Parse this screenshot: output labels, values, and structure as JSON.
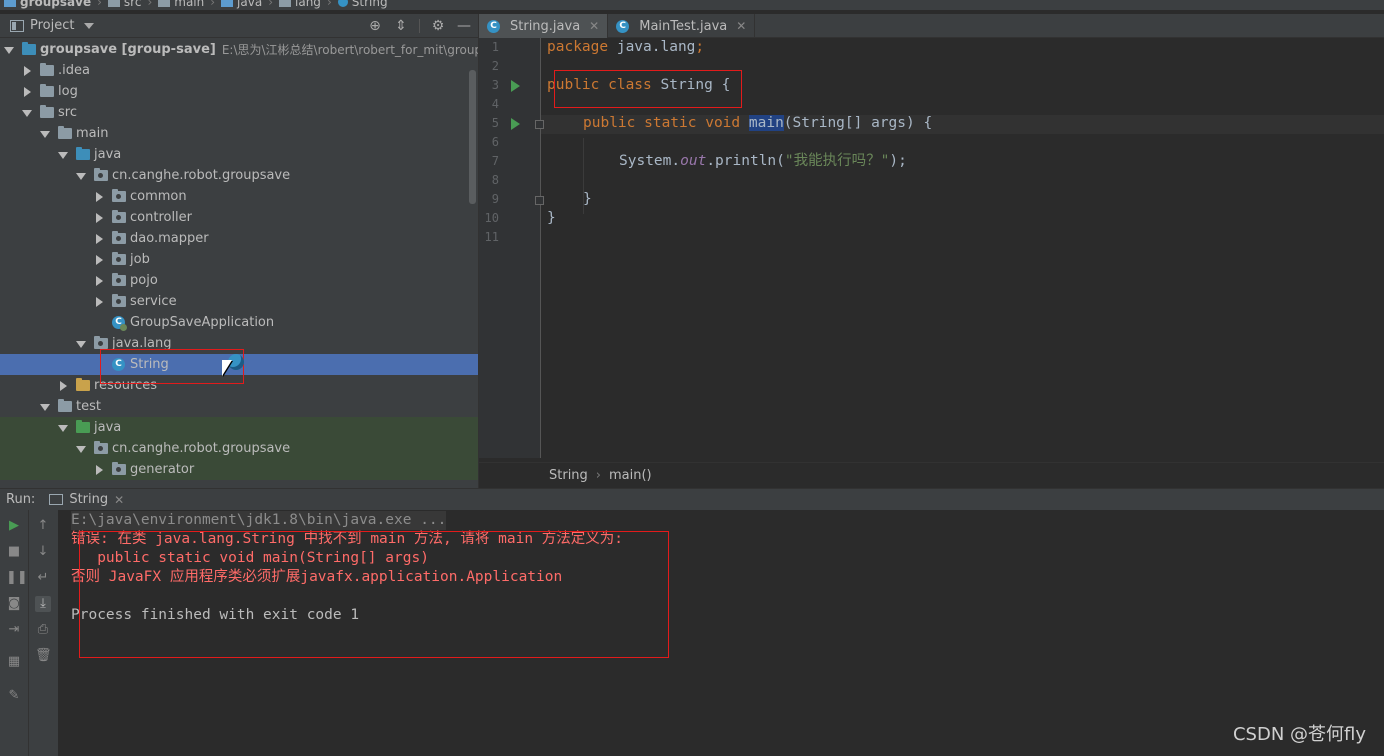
{
  "breadcrumb": [
    "groupsave",
    "src",
    "main",
    "java",
    "lang",
    "String"
  ],
  "project_panel": {
    "title": "Project",
    "tree": [
      {
        "label": "groupsave [group-save]",
        "path": "E:\\思为\\江彬总结\\robert\\robert_for_mit\\groupsave",
        "expanded": true,
        "icon": "module-folder-icon"
      },
      {
        "label": ".idea",
        "expanded": false,
        "icon": "folder-icon"
      },
      {
        "label": "log",
        "expanded": false,
        "icon": "folder-icon"
      },
      {
        "label": "src",
        "expanded": true,
        "icon": "folder-icon"
      },
      {
        "label": "main",
        "expanded": true,
        "icon": "folder-icon"
      },
      {
        "label": "java",
        "expanded": true,
        "icon": "source-folder-icon"
      },
      {
        "label": "cn.canghe.robot.groupsave",
        "expanded": true,
        "icon": "package-icon"
      },
      {
        "label": "common",
        "expanded": false,
        "icon": "package-icon"
      },
      {
        "label": "controller",
        "expanded": false,
        "icon": "package-icon"
      },
      {
        "label": "dao.mapper",
        "expanded": false,
        "icon": "package-icon"
      },
      {
        "label": "job",
        "expanded": false,
        "icon": "package-icon"
      },
      {
        "label": "pojo",
        "expanded": false,
        "icon": "package-icon"
      },
      {
        "label": "service",
        "expanded": false,
        "icon": "package-icon"
      },
      {
        "label": "GroupSaveApplication",
        "icon": "spring-class-icon"
      },
      {
        "label": "java.lang",
        "expanded": true,
        "icon": "package-icon"
      },
      {
        "label": "String",
        "icon": "class-icon",
        "selected": true
      },
      {
        "label": "resources",
        "expanded": false,
        "icon": "resources-folder-icon"
      },
      {
        "label": "test",
        "expanded": true,
        "icon": "folder-icon"
      },
      {
        "label": "java",
        "expanded": true,
        "icon": "test-folder-icon"
      },
      {
        "label": "cn.canghe.robot.groupsave",
        "expanded": true,
        "icon": "package-icon"
      },
      {
        "label": "generator",
        "expanded": false,
        "icon": "package-icon"
      }
    ]
  },
  "editor": {
    "tabs": [
      {
        "label": "String.java",
        "active": true
      },
      {
        "label": "MainTest.java",
        "active": false
      }
    ],
    "line_numbers": [
      "1",
      "2",
      "3",
      "4",
      "5",
      "6",
      "7",
      "8",
      "9",
      "10",
      "11"
    ],
    "code": {
      "l1_kw": "package",
      "l1_rest": " java.lang",
      "l1_semi": ";",
      "l3_kw": "public class",
      "l3_rest": " String {",
      "l5_kw": "public static void",
      "l5_main": "main",
      "l5_rest": "(String[] args) {",
      "l7_a": "System.",
      "l7_out": "out",
      "l7_b": ".println(",
      "l7_str": "\"我能执行吗？\"",
      "l7_c": ");",
      "l9": "}",
      "l10": "}"
    },
    "breadcrumb": [
      "String",
      "main()"
    ]
  },
  "run_panel": {
    "label": "Run:",
    "tab": "String",
    "console": {
      "cmd": "E:\\java\\environment\\jdk1.8\\bin\\java.exe ...",
      "err1": "错误: 在类 java.lang.String 中找不到 main 方法, 请将 main 方法定义为:",
      "err2": "   public static void main(String[] args)",
      "err3": "否则 JavaFX 应用程序类必须扩展javafx.application.Application",
      "finish": "Process finished with exit code 1"
    }
  },
  "watermark": "CSDN @苍何fly",
  "colors": {
    "highlight_box": "#e21b1b",
    "selection": "#4b6eaf",
    "error_text": "#ff6b68"
  }
}
